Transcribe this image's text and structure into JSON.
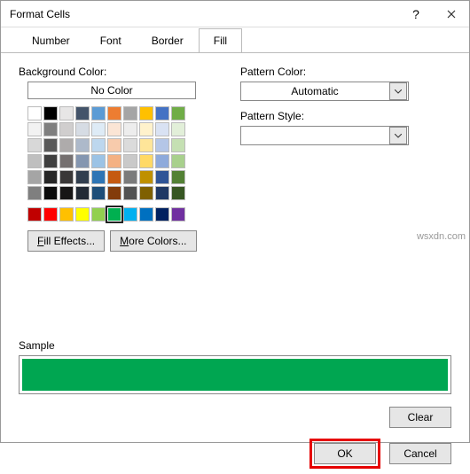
{
  "title": "Format Cells",
  "tabs": {
    "number": "Number",
    "font": "Font",
    "border": "Border",
    "fill": "Fill"
  },
  "fill": {
    "bg_label": "Background Color:",
    "no_color": "No Color",
    "pattern_color_label": "Pattern Color:",
    "pattern_color_value": "Automatic",
    "pattern_style_label": "Pattern Style:",
    "fill_effects": "Fill Effects...",
    "more_colors": "More Colors...",
    "sample_label": "Sample",
    "sample_color": "#00a651",
    "clear": "Clear"
  },
  "palette": {
    "row1": [
      "#ffffff",
      "#000000",
      "#e7e6e6",
      "#44546a",
      "#5b9bd5",
      "#ed7d31",
      "#a5a5a5",
      "#ffc000",
      "#4472c4",
      "#70ad47"
    ],
    "row2": [
      "#f2f2f2",
      "#7f7f7f",
      "#d0cece",
      "#d6dce4",
      "#deebf6",
      "#fbe5d5",
      "#ededed",
      "#fff2cc",
      "#d9e2f3",
      "#e2efd9"
    ],
    "row3": [
      "#d8d8d8",
      "#595959",
      "#aeabab",
      "#adb9ca",
      "#bdd7ee",
      "#f7cbac",
      "#dbdbdb",
      "#fee599",
      "#b4c6e7",
      "#c5e0b3"
    ],
    "row4": [
      "#bfbfbf",
      "#3f3f3f",
      "#757070",
      "#8496b0",
      "#9cc3e5",
      "#f4b183",
      "#c9c9c9",
      "#ffd965",
      "#8eaadb",
      "#a8d08d"
    ],
    "row5": [
      "#a5a5a5",
      "#262626",
      "#3a3838",
      "#323f4f",
      "#2e75b5",
      "#c55a11",
      "#7b7b7b",
      "#bf9000",
      "#2f5496",
      "#538135"
    ],
    "row6": [
      "#7f7f7f",
      "#0c0c0c",
      "#171616",
      "#222a35",
      "#1e4e79",
      "#833c0b",
      "#525252",
      "#7f6000",
      "#1f3864",
      "#375623"
    ],
    "std": [
      "#c00000",
      "#ff0000",
      "#ffc000",
      "#ffff00",
      "#92d050",
      "#00b050",
      "#00b0f0",
      "#0070c0",
      "#002060",
      "#7030a0"
    ],
    "selected": "#00b050"
  },
  "buttons": {
    "ok": "OK",
    "cancel": "Cancel"
  },
  "watermark": "wsxdn.com"
}
